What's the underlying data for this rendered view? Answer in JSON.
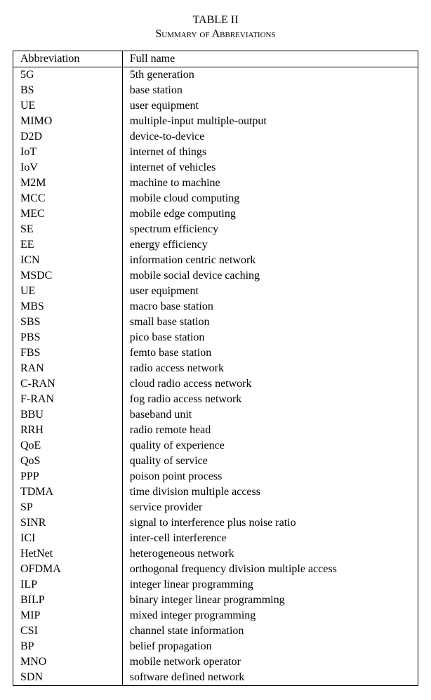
{
  "table": {
    "label": "TABLE II",
    "caption": "Summary of Abbreviations",
    "headers": {
      "abbr": "Abbreviation",
      "full": "Full name"
    },
    "rows": [
      {
        "abbr": "5G",
        "full": "5th generation"
      },
      {
        "abbr": "BS",
        "full": "base station"
      },
      {
        "abbr": "UE",
        "full": "user equipment"
      },
      {
        "abbr": "MIMO",
        "full": "multiple-input multiple-output"
      },
      {
        "abbr": "D2D",
        "full": "device-to-device"
      },
      {
        "abbr": "IoT",
        "full": "internet of things"
      },
      {
        "abbr": "IoV",
        "full": "internet of vehicles"
      },
      {
        "abbr": "M2M",
        "full": "machine to machine"
      },
      {
        "abbr": "MCC",
        "full": "mobile cloud computing"
      },
      {
        "abbr": "MEC",
        "full": "mobile edge computing"
      },
      {
        "abbr": "SE",
        "full": "spectrum efficiency"
      },
      {
        "abbr": "EE",
        "full": "energy efficiency"
      },
      {
        "abbr": "ICN",
        "full": "information centric network"
      },
      {
        "abbr": "MSDC",
        "full": "mobile social device caching"
      },
      {
        "abbr": "UE",
        "full": "user equipment"
      },
      {
        "abbr": "MBS",
        "full": "macro base station"
      },
      {
        "abbr": "SBS",
        "full": "small base station"
      },
      {
        "abbr": "PBS",
        "full": "pico base station"
      },
      {
        "abbr": "FBS",
        "full": "femto base station"
      },
      {
        "abbr": "RAN",
        "full": "radio access network"
      },
      {
        "abbr": "C-RAN",
        "full": "cloud radio access network"
      },
      {
        "abbr": "F-RAN",
        "full": "fog radio access network"
      },
      {
        "abbr": "BBU",
        "full": "baseband unit"
      },
      {
        "abbr": "RRH",
        "full": "radio remote head"
      },
      {
        "abbr": "QoE",
        "full": "quality of experience"
      },
      {
        "abbr": "QoS",
        "full": "quality of service"
      },
      {
        "abbr": "PPP",
        "full": "poison point process"
      },
      {
        "abbr": "TDMA",
        "full": "time division multiple access"
      },
      {
        "abbr": "SP",
        "full": "service provider"
      },
      {
        "abbr": "SINR",
        "full": "signal to interference plus noise ratio"
      },
      {
        "abbr": "ICI",
        "full": "inter-cell interference"
      },
      {
        "abbr": "HetNet",
        "full": "heterogeneous network"
      },
      {
        "abbr": "OFDMA",
        "full": "orthogonal frequency division multiple access"
      },
      {
        "abbr": "ILP",
        "full": "integer linear programming"
      },
      {
        "abbr": "BILP",
        "full": "binary integer linear programming"
      },
      {
        "abbr": "MIP",
        "full": "mixed integer programming"
      },
      {
        "abbr": "CSI",
        "full": "channel state information"
      },
      {
        "abbr": "BP",
        "full": "belief propagation"
      },
      {
        "abbr": "MNO",
        "full": "mobile network operator"
      },
      {
        "abbr": "SDN",
        "full": "software defined network"
      }
    ]
  }
}
